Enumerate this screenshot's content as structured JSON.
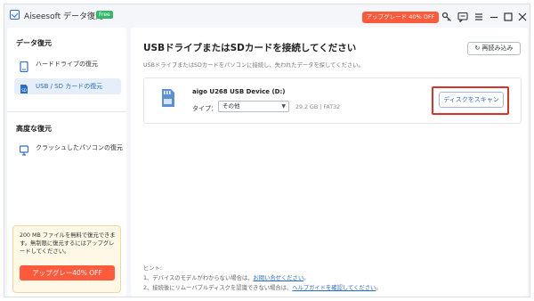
{
  "app": {
    "title": "Aiseesoft データ復元",
    "badge": "Free",
    "upgrade_label": "アップグレード 40% OFF",
    "accent_color": "#2a6fc9",
    "promo_color": "#ff5a3c"
  },
  "titlebar_icons": [
    "key-icon",
    "feedback-icon",
    "menu-icon",
    "minimize-icon",
    "maximize-icon",
    "close-icon"
  ],
  "sidebar": {
    "section1_title": "データ復元",
    "items": [
      {
        "label": "ハードドライブの復元",
        "icon": "hard-drive-icon",
        "active": false
      },
      {
        "label": "USB / SD カードの復元",
        "icon": "sd-card-icon",
        "active": true
      }
    ],
    "section2_title": "高度な復元",
    "items2": [
      {
        "label": "クラッシュしたパソコンの復元",
        "icon": "crashed-pc-icon",
        "active": false
      }
    ],
    "promo": {
      "text": "200 MB ファイルを無料で復元できます。無制限に復元するにはアップグレードしてください。",
      "button_label": "アップグレー40% OFF"
    }
  },
  "main": {
    "title": "USBドライブまたはSDカードを接続してください",
    "reload_label": "再読み込み",
    "subtitle": "USBドライブまたはSDカードをパソコンに接続し、失われたデータを探してください。",
    "device": {
      "name": "aigo U268 USB Device (D:)",
      "type_label": "タイプ：",
      "type_value": "その他",
      "size": "29.2 GB",
      "filesystem": "FAT32",
      "scan_label": "ディスクをスキャン"
    },
    "hint": {
      "title": "ヒント:",
      "line1_prefix": "1、デバイスのモデルがわからない場合は、",
      "line1_link": "お問い合せください",
      "line1_suffix": "。",
      "line2_prefix": "2、接続後にリムーバブルディスクを認識できない場合は、",
      "line2_link": "ヘルプガイドを確認してください",
      "line2_suffix": "。"
    }
  }
}
